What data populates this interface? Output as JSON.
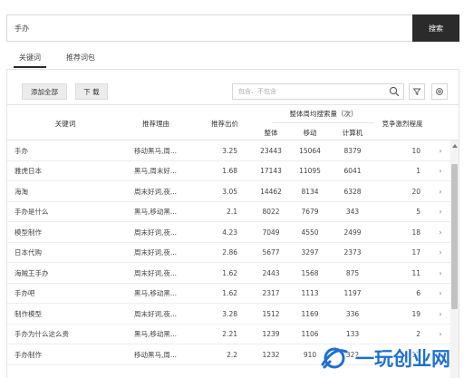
{
  "search": {
    "value": "手办",
    "button_label": "搜索"
  },
  "tabs": [
    {
      "label": "关键词",
      "active": true
    },
    {
      "label": "推荐词包",
      "active": false
    }
  ],
  "toolbar": {
    "add_all_label": "添加全部",
    "download_label": "下 载",
    "filter_placeholder": "包含、不包含",
    "icons": [
      "search-icon",
      "filter-icon",
      "settings-icon"
    ]
  },
  "table": {
    "headers": {
      "keyword": "关键词",
      "reason": "推荐理由",
      "bid": "推荐出价",
      "search_group": "整体周均搜索量（次）",
      "total": "整体",
      "mobile": "移动",
      "pc": "计算机",
      "competition": "竞争激烈程度"
    },
    "rows": [
      {
        "keyword": "手办",
        "reason": "移动黑马,周...",
        "bid": "3.25",
        "total": "23443",
        "mobile": "15064",
        "pc": "8379",
        "competition": "10"
      },
      {
        "keyword": "雅虎日本",
        "reason": "黑马,周末好...",
        "bid": "1.68",
        "total": "17143",
        "mobile": "11095",
        "pc": "6041",
        "competition": "1"
      },
      {
        "keyword": "海淘",
        "reason": "周末好词,夜...",
        "bid": "3.05",
        "total": "14462",
        "mobile": "8134",
        "pc": "6328",
        "competition": "20"
      },
      {
        "keyword": "手办是什么",
        "reason": "黑马,移动黑...",
        "bid": "2.1",
        "total": "8022",
        "mobile": "7679",
        "pc": "343",
        "competition": "5"
      },
      {
        "keyword": "模型制作",
        "reason": "周末好词,夜...",
        "bid": "4.23",
        "total": "7049",
        "mobile": "4550",
        "pc": "2499",
        "competition": "18"
      },
      {
        "keyword": "日本代购",
        "reason": "周末好词,夜...",
        "bid": "2.86",
        "total": "5677",
        "mobile": "3297",
        "pc": "2373",
        "competition": "17"
      },
      {
        "keyword": "海贼王手办",
        "reason": "周末好词,夜...",
        "bid": "1.62",
        "total": "2443",
        "mobile": "1568",
        "pc": "875",
        "competition": "11"
      },
      {
        "keyword": "手办吧",
        "reason": "黑马,移动黑...",
        "bid": "1.62",
        "total": "2317",
        "mobile": "1113",
        "pc": "1197",
        "competition": "6"
      },
      {
        "keyword": "制作模型",
        "reason": "周末好词,夜...",
        "bid": "3.28",
        "total": "1512",
        "mobile": "1169",
        "pc": "336",
        "competition": "19"
      },
      {
        "keyword": "手办为什么这么贵",
        "reason": "黑马,移动黑...",
        "bid": "2.21",
        "total": "1239",
        "mobile": "1106",
        "pc": "133",
        "competition": "2"
      },
      {
        "keyword": "手办制作",
        "reason": "移动黑马,周...",
        "bid": "2.2",
        "total": "1232",
        "mobile": "910",
        "pc": "322",
        "competition": "12"
      }
    ],
    "row_arrow": "›"
  },
  "watermark": {
    "text": "一玩创业网"
  },
  "colors": {
    "search_button": "#2b2b2b",
    "watermark": "#1e6fd1",
    "scroll_thumb": "#c2c2c2"
  }
}
